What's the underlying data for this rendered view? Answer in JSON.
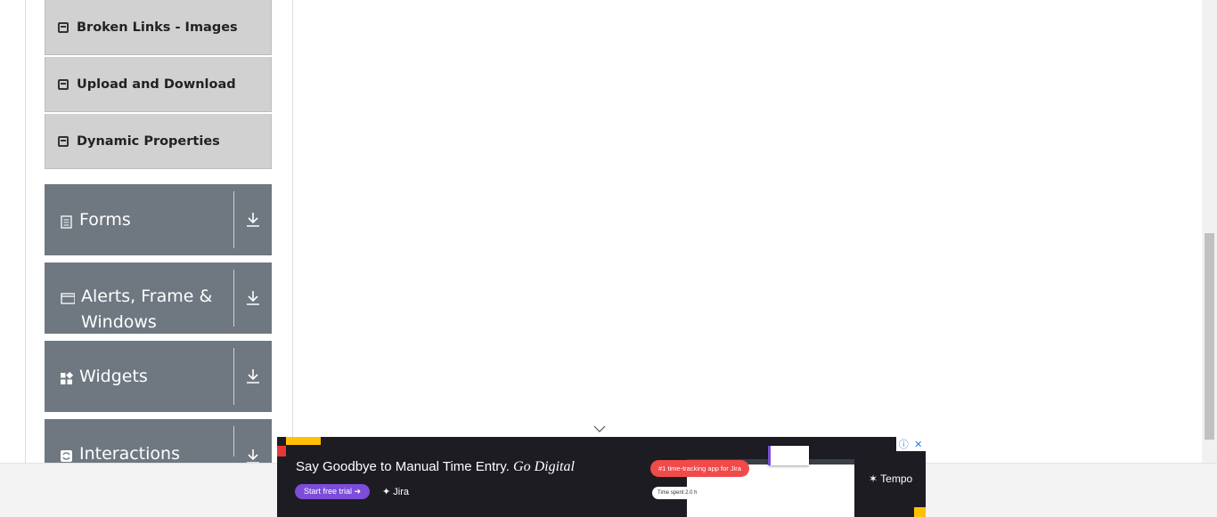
{
  "sidebar": {
    "elements_items": [
      {
        "label": "Broken Links - Images"
      },
      {
        "label": "Upload and Download"
      },
      {
        "label": "Dynamic Properties"
      }
    ],
    "groups": [
      {
        "label": "Forms",
        "icon": "form-icon"
      },
      {
        "label": "Alerts, Frame & Windows",
        "icon": "window-icon"
      },
      {
        "label": "Widgets",
        "icon": "widgets-icon"
      },
      {
        "label": "Interactions",
        "icon": "interactions-icon"
      }
    ]
  },
  "ad": {
    "headline": "Say Goodbye to Manual Time Entry.",
    "headline_em": "Go Digital",
    "cta": "Start free trial",
    "partner": "Jira",
    "pill": "#1 time-tracking app for Jira",
    "pill2": "Time spent  2.0 h",
    "brand": "Tempo"
  },
  "colors": {
    "group_bg": "#6f7780",
    "subitem_bg": "#d1d1d1",
    "ad_bg": "#1d1c23",
    "cta": "#7c4dd8"
  }
}
